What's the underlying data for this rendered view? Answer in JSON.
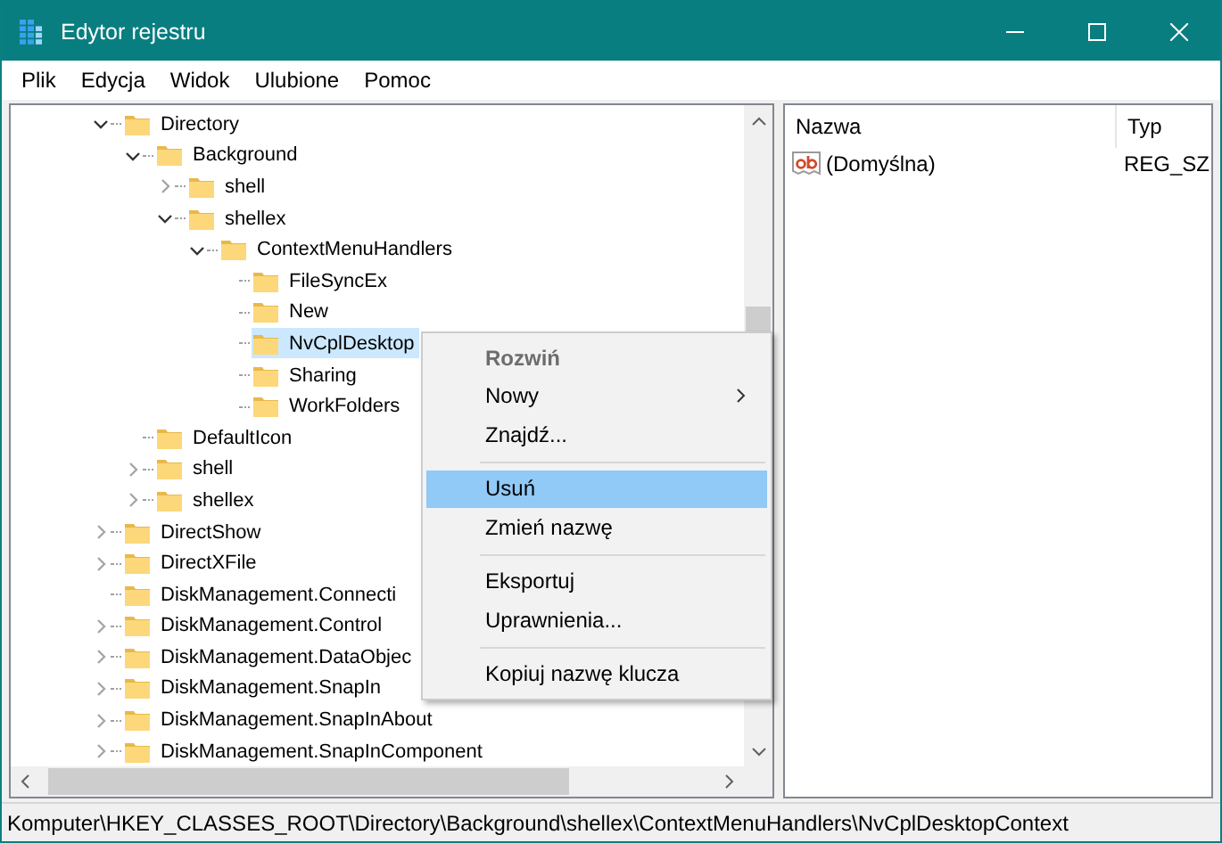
{
  "window": {
    "title": "Edytor rejestru"
  },
  "menu_bar": [
    "Plik",
    "Edycja",
    "Widok",
    "Ulubione",
    "Pomoc"
  ],
  "tree": [
    {
      "label": "Directory",
      "expanded": true,
      "selected": false,
      "children": [
        {
          "label": "Background",
          "expanded": true,
          "selected": false,
          "children": [
            {
              "label": "shell",
              "expanded": false,
              "selected": false
            },
            {
              "label": "shellex",
              "expanded": true,
              "selected": false,
              "children": [
                {
                  "label": "ContextMenuHandlers",
                  "expanded": true,
                  "selected": false,
                  "children": [
                    {
                      "label": "FileSyncEx",
                      "selected": false
                    },
                    {
                      "label": "New",
                      "selected": false
                    },
                    {
                      "label": "NvCplDesktop",
                      "selected": true
                    },
                    {
                      "label": "Sharing",
                      "selected": false
                    },
                    {
                      "label": "WorkFolders",
                      "selected": false
                    }
                  ]
                }
              ]
            }
          ]
        },
        {
          "label": "DefaultIcon",
          "selected": false
        },
        {
          "label": "shell",
          "expanded": false,
          "selected": false
        },
        {
          "label": "shellex",
          "expanded": false,
          "selected": false
        }
      ]
    },
    {
      "label": "DirectShow",
      "expanded": false,
      "selected": false
    },
    {
      "label": "DirectXFile",
      "expanded": false,
      "selected": false
    },
    {
      "label": "DiskManagement.Connecti",
      "selected": false
    },
    {
      "label": "DiskManagement.Control",
      "expanded": false,
      "selected": false
    },
    {
      "label": "DiskManagement.DataObjec",
      "expanded": false,
      "selected": false
    },
    {
      "label": "DiskManagement.SnapIn",
      "expanded": false,
      "selected": false
    },
    {
      "label": "DiskManagement.SnapInAbout",
      "expanded": false,
      "selected": false
    },
    {
      "label": "DiskManagement.SnapInComponent",
      "expanded": false,
      "selected": false
    }
  ],
  "values": {
    "columns": [
      "Nazwa",
      "Typ"
    ],
    "rows": [
      {
        "name": "(Domyślna)",
        "type": "REG_SZ"
      }
    ]
  },
  "context_menu": [
    {
      "kind": "item",
      "label": "Rozwiń",
      "default": true,
      "disabled": true,
      "submenu": false,
      "selected": false
    },
    {
      "kind": "item",
      "label": "Nowy",
      "default": false,
      "disabled": false,
      "submenu": true,
      "selected": false
    },
    {
      "kind": "item",
      "label": "Znajdź...",
      "default": false,
      "disabled": false,
      "submenu": false,
      "selected": false
    },
    {
      "kind": "separator"
    },
    {
      "kind": "item",
      "label": "Usuń",
      "default": false,
      "disabled": false,
      "submenu": false,
      "selected": true
    },
    {
      "kind": "item",
      "label": "Zmień nazwę",
      "default": false,
      "disabled": false,
      "submenu": false,
      "selected": false
    },
    {
      "kind": "separator"
    },
    {
      "kind": "item",
      "label": "Eksportuj",
      "default": false,
      "disabled": false,
      "submenu": false,
      "selected": false
    },
    {
      "kind": "item",
      "label": "Uprawnienia...",
      "default": false,
      "disabled": false,
      "submenu": false,
      "selected": false
    },
    {
      "kind": "separator"
    },
    {
      "kind": "item",
      "label": "Kopiuj nazwę klucza",
      "default": false,
      "disabled": false,
      "submenu": false,
      "selected": false
    }
  ],
  "status_bar": "Komputer\\HKEY_CLASSES_ROOT\\Directory\\Background\\shellex\\ContextMenuHandlers\\NvCplDesktopContext"
}
